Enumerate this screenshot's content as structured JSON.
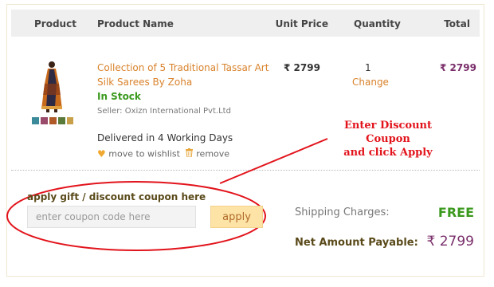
{
  "table": {
    "headers": {
      "product": "Product",
      "product_name": "Product Name",
      "unit_price": "Unit Price",
      "quantity": "Quantity",
      "total": "Total"
    }
  },
  "item": {
    "name": "Collection of 5 Traditional Tassar Art Silk Sarees By Zoha",
    "stock_status": "In Stock",
    "seller": "Seller: Oxizn International Pvt.Ltd",
    "delivery": "Delivered in 4 Working Days",
    "wishlist_label": "move to wishlist",
    "remove_label": "remove",
    "unit_price": "₹ 2799",
    "quantity": "1",
    "change_label": "Change",
    "total": "₹ 2799"
  },
  "annotation": {
    "line1": "Enter Discount Coupon",
    "line2": "and click Apply",
    "color": "#e2131b"
  },
  "coupon": {
    "label": "apply gift / discount coupon here",
    "placeholder": "enter coupon code here",
    "apply_label": "apply"
  },
  "summary": {
    "shipping_label": "Shipping Charges:",
    "shipping_value": "FREE",
    "net_label": "Net Amount Payable:",
    "net_value": "₹ 2799"
  },
  "colors": {
    "accent_orange": "#d9822b",
    "in_stock_green": "#3b9a1e",
    "price_purple": "#7a2e6b",
    "apply_button_bg": "#fde3a6"
  }
}
